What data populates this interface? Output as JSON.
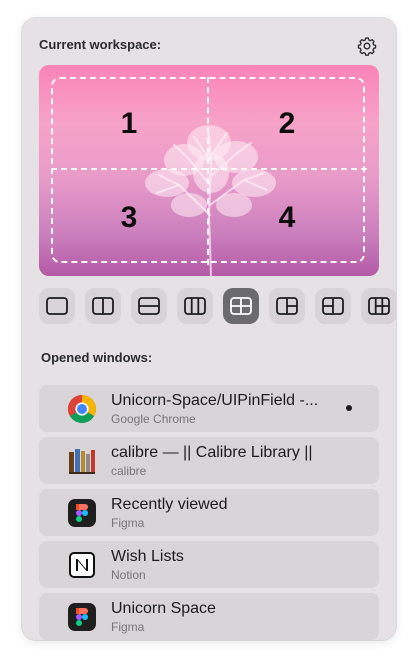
{
  "workspace": {
    "title": "Current workspace:",
    "zones": [
      "1",
      "2",
      "3",
      "4"
    ],
    "settings_icon": "gear-icon"
  },
  "layouts": [
    {
      "name": "full",
      "active": false
    },
    {
      "name": "halves-vertical",
      "active": false
    },
    {
      "name": "halves-horizontal",
      "active": false
    },
    {
      "name": "thirds-vertical",
      "active": false
    },
    {
      "name": "quarters",
      "active": true
    },
    {
      "name": "left-half-right-split",
      "active": false
    },
    {
      "name": "left-split-right-half",
      "active": false
    },
    {
      "name": "left-column-grid",
      "active": false
    }
  ],
  "windows": {
    "title": "Opened windows:",
    "items": [
      {
        "title": "Unicorn-Space/UIPinField -...",
        "app": "Google Chrome",
        "icon": "chrome-icon",
        "active": true
      },
      {
        "title": "calibre — || Calibre Library ||",
        "app": "calibre",
        "icon": "calibre-icon",
        "active": false
      },
      {
        "title": "Recently viewed",
        "app": "Figma",
        "icon": "figma-icon",
        "active": false
      },
      {
        "title": "Wish Lists",
        "app": "Notion",
        "icon": "notion-icon",
        "active": false
      },
      {
        "title": "Unicorn Space",
        "app": "Figma",
        "icon": "figma-icon",
        "active": false
      }
    ]
  },
  "colors": {
    "panel": "#e6e1e4",
    "item": "#d9d4d7",
    "active_layout": "#6b6b6d",
    "preview_top": "#fb83b8",
    "preview_bottom": "#b45aa6"
  }
}
